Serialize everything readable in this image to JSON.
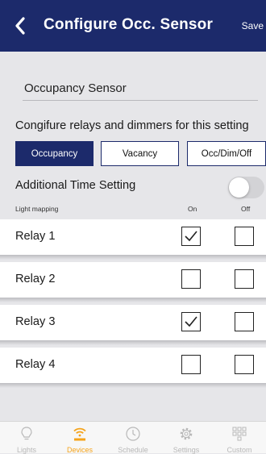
{
  "header": {
    "title": "Configure Occ. Sensor",
    "save_label": "Save"
  },
  "sensor_name": "Occupancy Sensor",
  "configure_text": "Congifure relays and dimmers for this setting",
  "modes": [
    {
      "label": "Occupancy",
      "selected": true
    },
    {
      "label": "Vacancy",
      "selected": false
    },
    {
      "label": "Occ/Dim/Off",
      "selected": false
    }
  ],
  "additional_time": {
    "label": "Additional Time Setting",
    "enabled": false
  },
  "light_mapping": {
    "title": "Light mapping",
    "on_label": "On",
    "off_label": "Off"
  },
  "relays": [
    {
      "label": "Relay 1",
      "on": true,
      "off": false
    },
    {
      "label": "Relay 2",
      "on": false,
      "off": false
    },
    {
      "label": "Relay 3",
      "on": true,
      "off": false
    },
    {
      "label": "Relay 4",
      "on": false,
      "off": false
    }
  ],
  "tabs": [
    {
      "label": "Lights",
      "icon": "bulb-icon",
      "active": false
    },
    {
      "label": "Devices",
      "icon": "wireless-icon",
      "active": true
    },
    {
      "label": "Schedule",
      "icon": "clock-icon",
      "active": false
    },
    {
      "label": "Settings",
      "icon": "gear-icon",
      "active": false
    },
    {
      "label": "Custom",
      "icon": "grid-icon",
      "active": false
    }
  ],
  "colors": {
    "header": "#1c2a6b",
    "active_tab": "#f5a31a",
    "background": "#e6e6e9"
  }
}
